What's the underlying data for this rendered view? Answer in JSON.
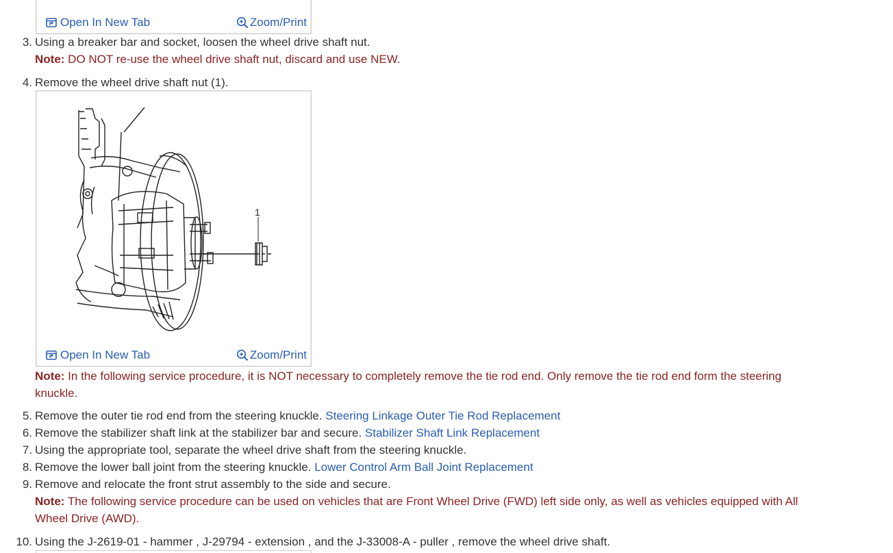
{
  "figure_toolbar": {
    "open_label": "Open In New Tab",
    "zoom_label": "Zoom/Print",
    "open_icon": "open-new-tab-icon",
    "zoom_icon": "zoom-in-icon"
  },
  "figure": {
    "callout": "1"
  },
  "steps": {
    "s3": {
      "num": "3.",
      "text": "Using a breaker bar and socket, loosen the wheel drive shaft nut."
    },
    "s3_note": {
      "label": "Note:",
      "text": " DO NOT re-use the wheel drive shaft nut, discard and use NEW."
    },
    "s4": {
      "num": "4.",
      "text": "Remove the wheel drive shaft nut (1)."
    },
    "note2": {
      "label": "Note:",
      "line1": " In the following service procedure, it is NOT necessary to completely remove the tie rod end. Only remove the tie rod end form the steering",
      "line2": "knuckle."
    },
    "s5": {
      "num": "5.",
      "text": "Remove the outer tie rod end from the steering knuckle. ",
      "link": "Steering Linkage Outer Tie Rod Replacement"
    },
    "s6": {
      "num": "6.",
      "text": "Remove the stabilizer shaft link at the stabilizer bar and secure. ",
      "link": "Stabilizer Shaft Link Replacement"
    },
    "s7": {
      "num": "7.",
      "text": "Using the appropriate tool, separate the wheel drive shaft from the steering knuckle."
    },
    "s8": {
      "num": "8.",
      "text": "Remove the lower ball joint from the steering knuckle. ",
      "link": "Lower Control Arm Ball Joint Replacement"
    },
    "s9": {
      "num": "9.",
      "text": "Remove and relocate the front strut assembly to the side and secure."
    },
    "note3": {
      "label": "Note:",
      "line1": " The following service procedure can be used on vehicles that are Front Wheel Drive (FWD) left side only, as well as vehicles equipped with All",
      "line2": "Wheel Drive (AWD)."
    },
    "s10": {
      "num": "10.",
      "text": "Using the J-2619-01 - hammer , J-29794 - extension , and the J-33008-A - puller , remove the wheel drive shaft."
    }
  },
  "colors": {
    "link": "#2a5db0",
    "note": "#8b2323",
    "text": "#333333"
  }
}
